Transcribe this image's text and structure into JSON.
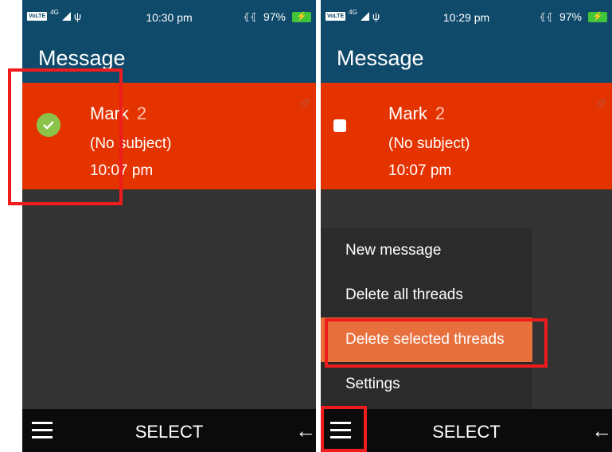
{
  "screens": [
    {
      "status": {
        "volte": "VoLTE",
        "network": "4G",
        "usb": "ψ",
        "time": "10:30 pm",
        "vibrate": "⦃⦃",
        "battery": "97%",
        "charging": "⚡"
      },
      "title": "Message",
      "thread": {
        "name": "Mark",
        "count": "2",
        "subject": "(No subject)",
        "time": "10:07 pm",
        "selected": true
      },
      "softkeys": {
        "center": "SELECT",
        "right": "←"
      }
    },
    {
      "status": {
        "volte": "VoLTE",
        "network": "4G",
        "usb": "ψ",
        "time": "10:29 pm",
        "vibrate": "⦃⦃",
        "battery": "97%",
        "charging": "⚡"
      },
      "title": "Message",
      "thread": {
        "name": "Mark",
        "count": "2",
        "subject": "(No subject)",
        "time": "10:07 pm",
        "selected": false
      },
      "menu": {
        "items": [
          "New message",
          "Delete all threads",
          "Delete selected threads",
          "Settings"
        ],
        "selected_index": 2
      },
      "softkeys": {
        "center": "SELECT",
        "right": "←"
      }
    }
  ],
  "colors": {
    "header": "#0f4a6b",
    "thread": "#e53300",
    "highlight": "#ee1c1c",
    "menu_selected": "#e8703d",
    "check": "#8bc34a",
    "battery": "#3fc43a"
  }
}
